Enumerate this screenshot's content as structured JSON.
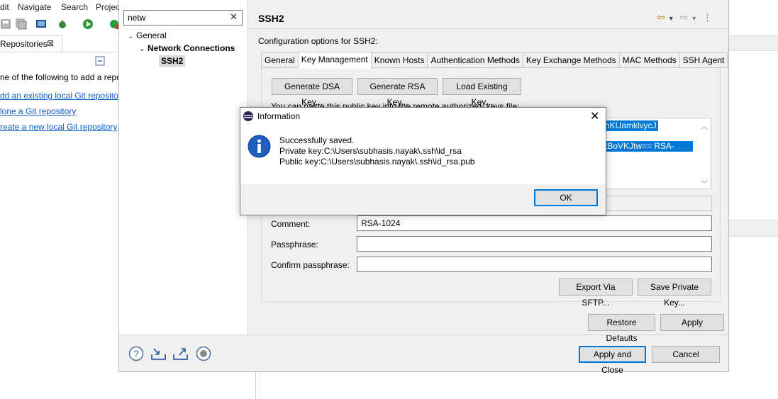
{
  "menu": {
    "items": [
      "dit",
      "Navigate",
      "Search",
      "Projec"
    ]
  },
  "git_repositories": {
    "tab_label": "Repositories",
    "intro": "ne of the following to add a repo",
    "links": [
      "dd an existing local Git repository",
      "lone a Git repository",
      "reate a new local Git repository"
    ]
  },
  "preferences": {
    "filter_value": "netw",
    "tree": {
      "general": "General",
      "network_connections": "Network Connections",
      "ssh2": "SSH2"
    },
    "page_title": "SSH2",
    "config_label": "Configuration options for SSH2:",
    "tabs": [
      "General",
      "Key Management",
      "Known Hosts",
      "Authentication Methods",
      "Key Exchange Methods",
      "MAC Methods",
      "SSH Agent"
    ],
    "buttons": {
      "generate_dsa": "Generate DSA Key...",
      "generate_rsa": "Generate RSA Key...",
      "load_existing": "Load Existing Key...",
      "export_sftp": "Export Via SFTP...",
      "save_private": "Save Private Key...",
      "restore_defaults": "Restore Defaults",
      "apply": "Apply",
      "apply_close": "Apply and Close",
      "cancel": "Cancel"
    },
    "paste_label": "You can paste this public key into the remote authorized_keys file:",
    "key_fragment_1": "nKUamklvycJ",
    "key_fragment_2": "tBoVKJtw== RSA-1024",
    "comment_label": "Comment:",
    "comment_value": "RSA-1024",
    "passphrase_label": "Passphrase:",
    "confirm_passphrase_label": "Confirm passphrase:"
  },
  "info_dialog": {
    "title": "Information",
    "line1": "Successfully saved.",
    "line2": "Private key:C:\\Users\\subhasis.nayak\\.ssh\\id_rsa",
    "line3": "Public key:C:\\Users\\subhasis.nayak\\.ssh\\id_rsa.pub",
    "ok": "OK"
  },
  "colors": {
    "selection": "#0078d7",
    "link": "#0b5ec7",
    "dialog_bg": "#f0f0f0"
  }
}
